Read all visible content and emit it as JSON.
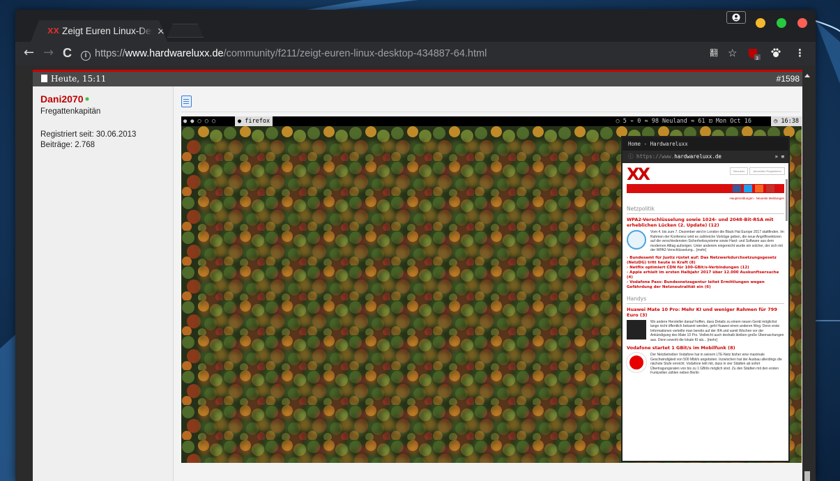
{
  "tab": {
    "title": "Zeigt Euren Linux-Desktop",
    "close": "×",
    "favicon": "XX"
  },
  "toolbar": {
    "back": "←",
    "forward": "→",
    "reload": "C",
    "info": "i",
    "url_scheme": "https://",
    "url_host": "www.hardwareluxx.de",
    "url_path": "/community/f211/zeigt-euren-linux-desktop-434887-64.html",
    "translate_icon": "翻",
    "star": "☆",
    "ext_badge": "3",
    "menu": "⋮"
  },
  "traffic_lights": {
    "colors": [
      "#f5b82e",
      "#27c93f",
      "#ff5f57"
    ]
  },
  "post": {
    "date": "Heute, 15:11",
    "number": "#1598",
    "user": {
      "name": "Dani2070",
      "rank": "Fregattenkapitän",
      "registered": "Registriert seit:  30.06.2013",
      "posts": "Beiträge:  2.768"
    }
  },
  "screenshot": {
    "topbar_workspaces": "● ● ○ ○ ○",
    "topbar_active": "● firefox",
    "topbar_status": "○ 5  ⌁ 0  ≈ 98 Neuland  ≈ 61  ⊡ Mon Oct 16",
    "topbar_clock": "◷ 16:38",
    "inner_title": "Home - Hardwareluxx",
    "inner_url_prefix": "ⓘ https://www.",
    "inner_url_host": "hardwareluxx.de",
    "inner_url_right": "»  ≡",
    "site_logo": "XX",
    "login_user": "Benutzer",
    "login_btn": "Anmelden Registrieren",
    "sub_links": "Hauptmeldungen · Neueste Meldungen",
    "section1": "Netzpolitik",
    "art1_title": "WPA2-Verschlüsselung sowie 1024- und 2048-Bit-RSA mit erheblichen Lücken (2. Update) (12)",
    "art1_text": "Vom 4. bis zum 7. Dezember wird in London die Black Hat Europe 2017 stattfinden. Im Rahmen der Konferenz wird es zahlreiche Vorträge geben, die neue Angriffsvektoren auf die verschiedensten Sicherheitssysteme sowie Hard- und Software aus dem modernen Alltag aufzeigen. Unter anderem eingereicht wurde ein solcher, der sich mit der WPA2-Verschlüsselung... [mehr]",
    "list1": [
      "› Bundesamt für Justiz rüstet auf: Das Netzwerkdurchsetzungsgesetz (NetzDG) tritt heute in Kraft (8)",
      "› Netflix optimiert CDN für 100-GBit/s-Verbindungen (12)",
      "› Apple erhielt im ersten Halbjahr 2017 über 12.000 Auskunftsersuche (4)",
      "› Vodafone Pass: Bundesnetzagentur leitet Ermittlungen wegen Gefährdung der Netzneutralität ein (6)"
    ],
    "section2": "Handys",
    "art2_title": "Huawei Mate 10 Pro: Mehr KI und weniger Rahmen für 799 Euro (3)",
    "art2_text": "Wo andere Hersteller darauf hoffen, dass Details zu einem neuen Gerät möglichst lange nicht öffentlich bekannt werden, geht Huawei einen anderen Weg. Denn erste Informationen verteilte man bereits auf der IFA und samit Wochen vor der Ankündigung des Mate 10 Pro. Vielleicht auch deshalb bleiben große Überraschungen aus. Denn sowohl die lokale KI als... [mehr]",
    "art3_title": "Vodafone startet 1 GBit/s im Mobilfunk (8)",
    "art3_text": "Der Netzbetreiber Vodafone hat in seinem LTE-Netz bisher eine maximale Geschwindigkeit von 500 Mbit/s angeboten. Inzwischen hat der Ausbau allerdings die nächste Stufe erreicht. Vodafone teilt mit, dass in vier Städten ab sofort Übertragungsraten von bis zu 1 GBit/s möglich sind. Zu den Städten mit den ersten Funkzellen zählen neben Berlin"
  }
}
